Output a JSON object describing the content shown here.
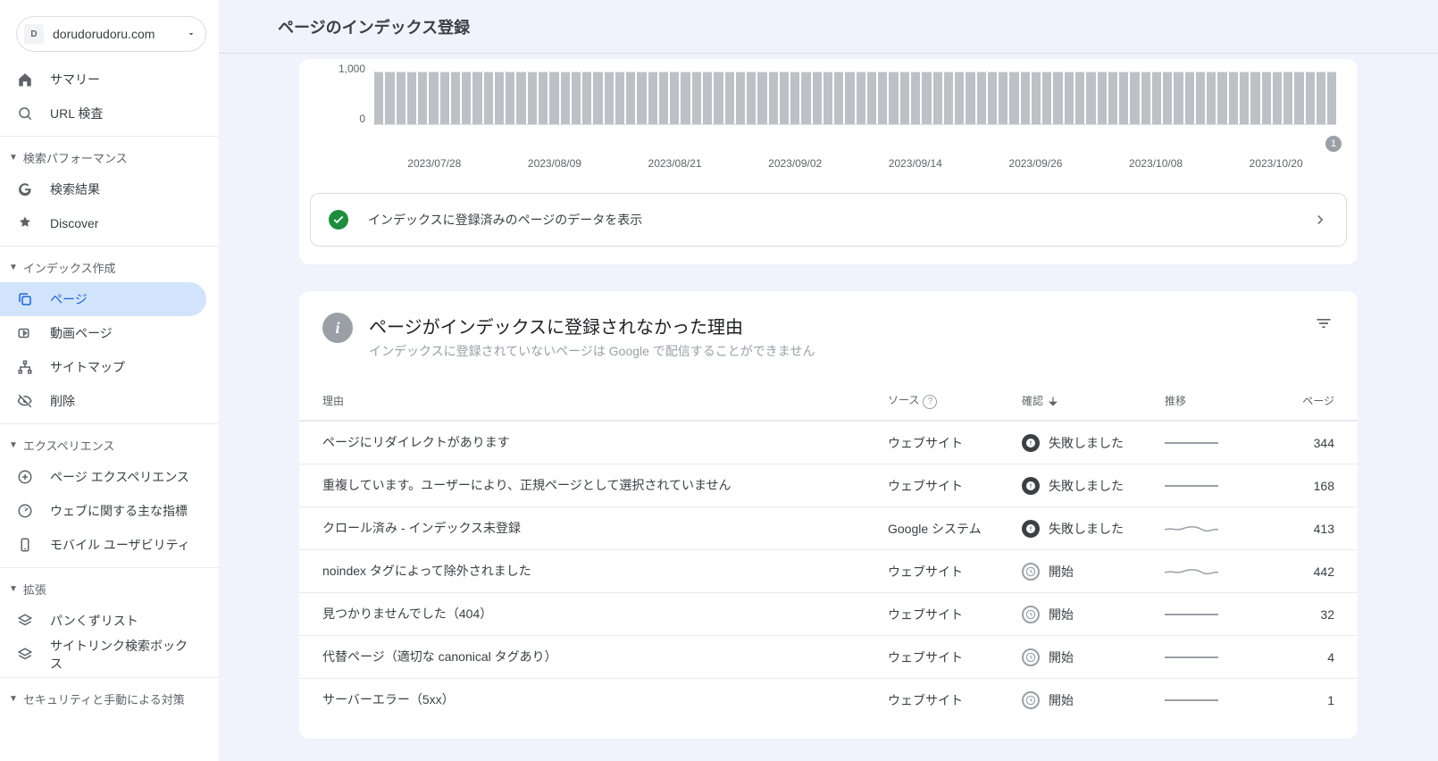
{
  "site_domain": "dorudorudoru.com",
  "page_title": "ページのインデックス登録",
  "sidebar": {
    "top": [
      {
        "label": "サマリー",
        "icon": "home"
      },
      {
        "label": "URL 検査",
        "icon": "search"
      }
    ],
    "sections": [
      {
        "header": "検索パフォーマンス",
        "items": [
          {
            "label": "検索結果",
            "icon": "g"
          },
          {
            "label": "Discover",
            "icon": "star"
          }
        ]
      },
      {
        "header": "インデックス作成",
        "items": [
          {
            "label": "ページ",
            "icon": "copy",
            "active": true
          },
          {
            "label": "動画ページ",
            "icon": "video"
          },
          {
            "label": "サイトマップ",
            "icon": "sitemap"
          },
          {
            "label": "削除",
            "icon": "hide"
          }
        ]
      },
      {
        "header": "エクスペリエンス",
        "items": [
          {
            "label": "ページ エクスペリエンス",
            "icon": "plus-circle"
          },
          {
            "label": "ウェブに関する主な指標",
            "icon": "speed"
          },
          {
            "label": "モバイル ユーザビリティ",
            "icon": "mobile"
          }
        ]
      },
      {
        "header": "拡張",
        "items": [
          {
            "label": "パンくずリスト",
            "icon": "layers"
          },
          {
            "label": "サイトリンク検索ボックス",
            "icon": "layers"
          }
        ]
      },
      {
        "header": "セキュリティと手動による対策",
        "items": []
      }
    ]
  },
  "chart_data": {
    "type": "bar",
    "ylim": [
      0,
      1000
    ],
    "ylabel": "",
    "xlabel": "",
    "y_ticks": [
      "1,000",
      "0"
    ],
    "categories": [
      "2023/07/28",
      "2023/08/09",
      "2023/08/21",
      "2023/09/02",
      "2023/09/14",
      "2023/09/26",
      "2023/10/08",
      "2023/10/20"
    ],
    "values": [
      1000,
      1000,
      1000,
      1000,
      1000,
      1000,
      1000,
      1000,
      1000,
      1000,
      1000,
      1000,
      1000,
      1000,
      1000,
      1000,
      1000,
      1000,
      1000,
      1000,
      1000,
      1000,
      1000,
      1000,
      1000,
      1000,
      1000,
      1000,
      1000,
      1000,
      1000,
      1000,
      1000,
      1000,
      1000,
      1000,
      1000,
      1000,
      1000,
      1000,
      1000,
      1000,
      1000,
      1000,
      1000,
      1000,
      1000,
      1000,
      1000,
      1000,
      1000,
      1000,
      1000,
      1000,
      1000,
      1000,
      1000,
      1000,
      1000,
      1000,
      1000,
      1000,
      1000,
      1000,
      1000,
      1000,
      1000,
      1000,
      1000,
      1000,
      1000,
      1000,
      1000,
      1000,
      1000,
      1000,
      1000,
      1000,
      1000,
      1000,
      1000,
      1000,
      1000,
      1000,
      1000,
      1000,
      1000,
      1000
    ],
    "marker_badge": "1"
  },
  "cta_label": "インデックスに登録済みのページのデータを表示",
  "reasons": {
    "title": "ページがインデックスに登録されなかった理由",
    "subtitle": "インデックスに登録されていないページは Google で配信することができません",
    "columns": {
      "reason": "理由",
      "source": "ソース",
      "confirm": "確認",
      "trend": "推移",
      "pages": "ページ"
    },
    "rows": [
      {
        "reason": "ページにリダイレクトがあります",
        "source": "ウェブサイト",
        "status": "失敗しました",
        "status_type": "fail",
        "pages": "344",
        "spark": "flat"
      },
      {
        "reason": "重複しています。ユーザーにより、正規ページとして選択されていません",
        "source": "ウェブサイト",
        "status": "失敗しました",
        "status_type": "fail",
        "pages": "168",
        "spark": "flat"
      },
      {
        "reason": "クロール済み - インデックス未登録",
        "source": "Google システム",
        "status": "失敗しました",
        "status_type": "fail",
        "pages": "413",
        "spark": "wavy"
      },
      {
        "reason": "noindex タグによって除外されました",
        "source": "ウェブサイト",
        "status": "開始",
        "status_type": "start",
        "pages": "442",
        "spark": "wavy"
      },
      {
        "reason": "見つかりませんでした（404）",
        "source": "ウェブサイト",
        "status": "開始",
        "status_type": "start",
        "pages": "32",
        "spark": "flat"
      },
      {
        "reason": "代替ページ（適切な canonical タグあり）",
        "source": "ウェブサイト",
        "status": "開始",
        "status_type": "start",
        "pages": "4",
        "spark": "flat"
      },
      {
        "reason": "サーバーエラー（5xx）",
        "source": "ウェブサイト",
        "status": "開始",
        "status_type": "start",
        "pages": "1",
        "spark": "flat"
      }
    ]
  }
}
